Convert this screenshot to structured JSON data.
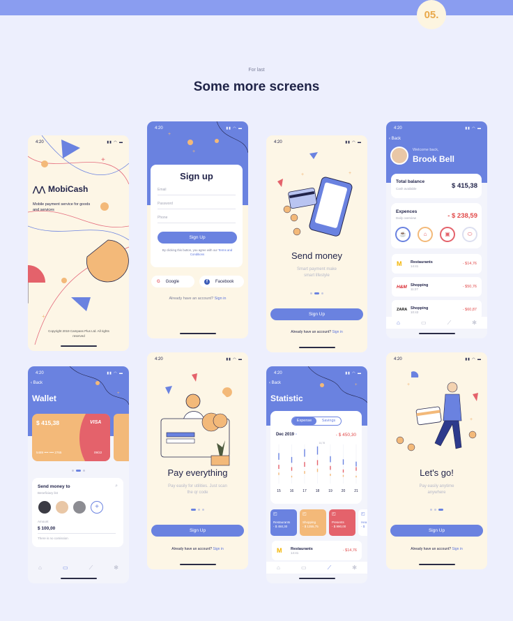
{
  "header": {
    "number": "05.",
    "kicker": "For last",
    "title": "Some more screens"
  },
  "time": "4:20",
  "mobicash": {
    "brand": "MobiCash",
    "tagline": "Mobile payment service for goods and services",
    "copyright": "Copyright 2019 Campass Plus Ltd. All rights reserved"
  },
  "signup": {
    "title": "Sign up",
    "email": "Email",
    "password": "Password",
    "phone": "Phone",
    "button": "Sign Up",
    "terms_pre": "By clicking this button, you agree with our",
    "terms_link": "Terms and Conditions",
    "google": "Google",
    "facebook": "Facebook",
    "have_account": "Already have an account?",
    "sign_in": "Sign in"
  },
  "send_money": {
    "title": "Send money",
    "subtitle": "Smart payment make smart lifestyle",
    "button": "Sign Up",
    "have_account": "Already have an account?",
    "sign_in": "Sign in"
  },
  "dashboard": {
    "back": "Back",
    "welcome": "Welcome back,",
    "name": "Brook Bell",
    "balance_label": "Total balance",
    "balance_sub": "Cash available",
    "balance": "$ 415,38",
    "expences_label": "Expences",
    "expences_sub": "Daily overview",
    "expences": "- $ 238,59",
    "rows": [
      {
        "logo": "M",
        "name": "Restaurants",
        "time": "14:41",
        "amount": "- $14,76"
      },
      {
        "logo": "H&M",
        "name": "Shopping",
        "time": "11:27",
        "amount": "- $50,76"
      },
      {
        "logo": "ZARA",
        "name": "Shopping",
        "time": "10:43",
        "amount": "- $60,87"
      }
    ]
  },
  "wallet": {
    "back": "Back",
    "title": "Wallet",
    "card_amount": "$ 415,38",
    "card_brand": "VISA",
    "card_number": "5489 •••• •••• 2765",
    "card_exp": "09/22",
    "send_title": "Send money to",
    "beneficiary": "Beneficiary list",
    "amount_label": "Amount",
    "amount": "$ 100,00",
    "commission": "There is no comission"
  },
  "pay": {
    "title": "Pay everything",
    "subtitle": "Pay easily for utilities. Just scan the qr code",
    "button": "Sign Up",
    "have_account": "Already have an account?",
    "sign_in": "Sign in"
  },
  "statistic": {
    "back": "Back",
    "title": "Statistic",
    "tab_expense": "Expense",
    "tab_savings": "Savings",
    "month": "Dec 2019",
    "amount": "- $ 450,30",
    "peak_label": "14,76",
    "chart_data": {
      "type": "bar",
      "categories": [
        "15",
        "16",
        "17",
        "18",
        "19",
        "20",
        "21"
      ],
      "series": [
        {
          "color": "#6a82e0",
          "values": [
            0.78,
            0.68,
            0.88,
            0.95,
            0.7,
            0.62,
            0.56
          ]
        },
        {
          "color": "#e4626b",
          "values": [
            0.48,
            0.42,
            0.55,
            0.6,
            0.45,
            0.36,
            0.42
          ]
        },
        {
          "color": "#f3b979",
          "values": [
            0.28,
            0.2,
            0.32,
            0.38,
            0.25,
            0.22,
            0.2
          ]
        }
      ]
    },
    "cats": [
      {
        "name": "Restaurants",
        "amount": "- $ 450,30",
        "color": "#6a82e0"
      },
      {
        "name": "Shopping",
        "amount": "- $ 1355,75",
        "color": "#f3b979"
      },
      {
        "name": "Presents",
        "amount": "- $ 990,00",
        "color": "#e4626b"
      },
      {
        "name": "Hea",
        "amount": "- $",
        "color": "#ffffff"
      }
    ],
    "row": {
      "logo": "M",
      "name": "Restaurants",
      "time": "14:41",
      "amount": "- $14,76"
    }
  },
  "letsgo": {
    "title": "Let's go!",
    "subtitle": "Pay easily anytime anywhere",
    "button": "Sign Up",
    "have_account": "Already have an account?",
    "sign_in": "Sign in"
  }
}
